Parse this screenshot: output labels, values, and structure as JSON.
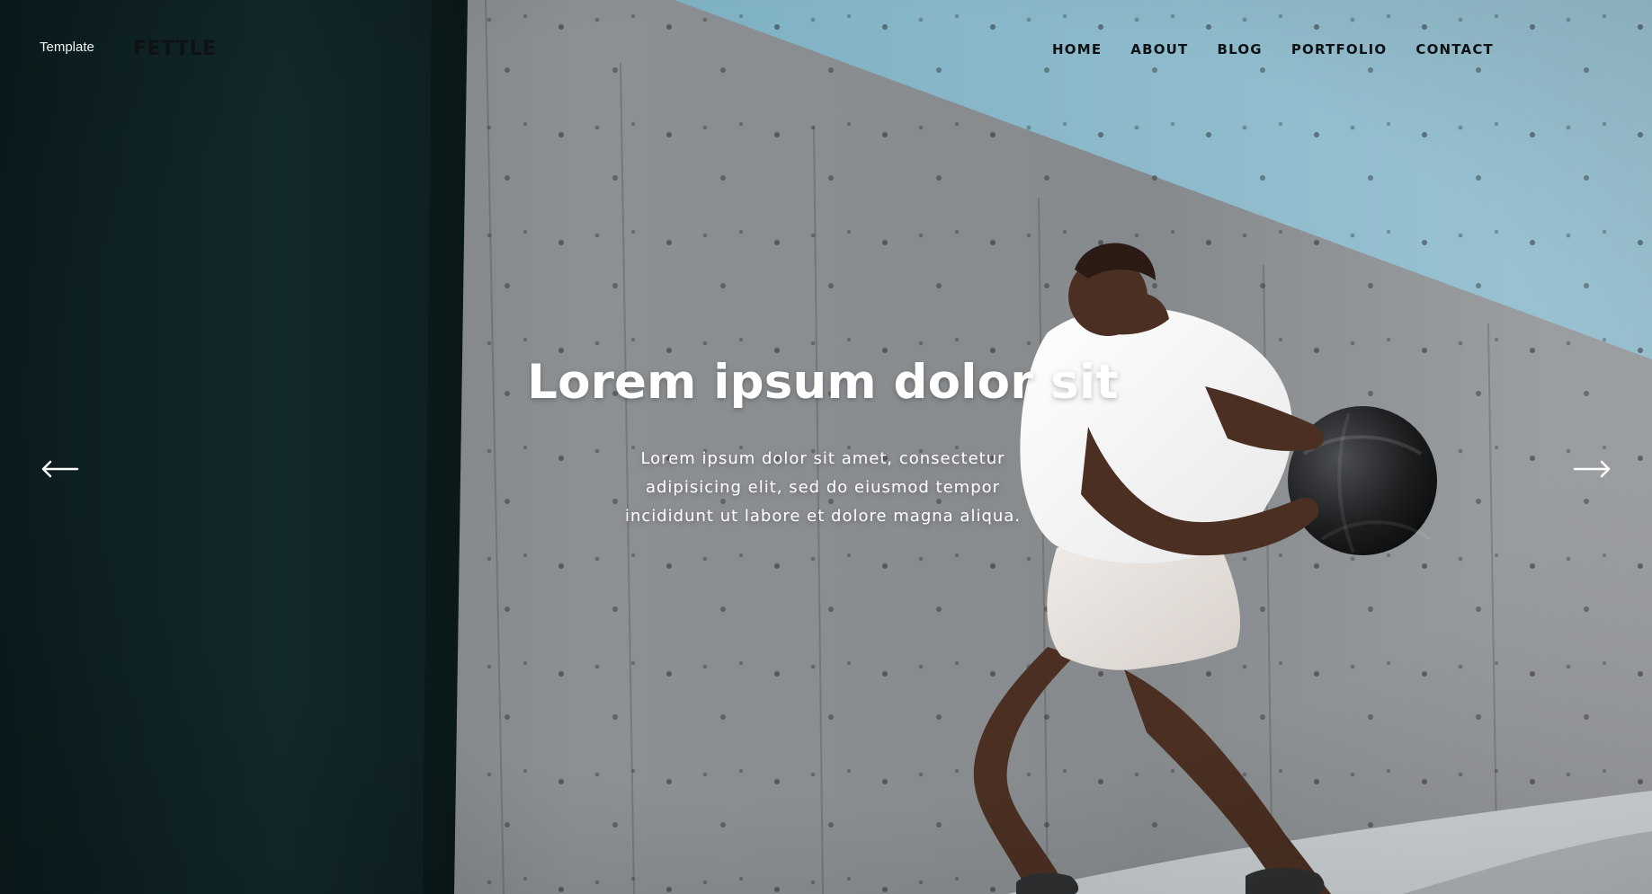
{
  "brand": {
    "template_label": "Template",
    "logo_text": "FETTLE"
  },
  "nav": {
    "items": [
      {
        "label": "HOME"
      },
      {
        "label": "ABOUT"
      },
      {
        "label": "BLOG"
      },
      {
        "label": "PORTFOLIO"
      },
      {
        "label": "CONTACT"
      }
    ]
  },
  "hero": {
    "title": "Lorem ipsum dolor sit",
    "description": "Lorem ipsum dolor sit amet, consectetur adipisicing elit, sed do eiusmod tempor incididunt ut labore et dolore magna aliqua.",
    "prev_icon": "arrow-left-icon",
    "next_icon": "arrow-right-icon"
  },
  "colors": {
    "sky": "#8FB9CC",
    "wall_light": "#8A8D90",
    "wall_dark": "#0E2426",
    "text_dark": "#0F1214",
    "text_light": "#FFFFFF"
  }
}
